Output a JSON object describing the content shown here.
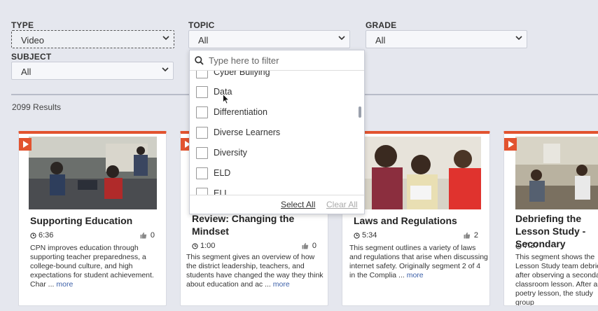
{
  "filters": {
    "type": {
      "label": "TYPE",
      "value": "Video"
    },
    "topic": {
      "label": "TOPIC",
      "value": "All"
    },
    "grade": {
      "label": "GRADE",
      "value": "All"
    },
    "subject": {
      "label": "SUBJECT",
      "value": "All"
    }
  },
  "topic_dropdown": {
    "placeholder": "Type here to filter",
    "options": [
      "Cyber Bullying",
      "Data",
      "Differentiation",
      "Diverse Learners",
      "Diversity",
      "ELD",
      "ELL"
    ],
    "select_all": "Select All",
    "clear_all": "Clear All"
  },
  "results": {
    "count_text": "2099 Results"
  },
  "cards": [
    {
      "title": "Supporting Education",
      "duration": "6:36",
      "likes": "0",
      "description": "CPN improves education through supporting teacher preparedness, a college-bound culture, and high expectations for student achievement. Char ...",
      "more": "more"
    },
    {
      "title": "Review: Changing the Mindset",
      "duration": "1:00",
      "likes": "0",
      "description": "This segment gives an overview of how the district leadership, teachers, and students have changed the way they think about education and ac ...",
      "more": "more"
    },
    {
      "title": "Laws and Regulations",
      "duration": "5:34",
      "likes": "2",
      "description": "This segment outlines a variety of laws and regulations that arise when discussing internet safety. Originally segment 2 of 4 in the Complia ...",
      "more": "more"
    },
    {
      "title": "Debriefing the Lesson Study - Secondary",
      "duration": "7:37",
      "likes": "",
      "description": "This segment shows the Lesson Study team debriefing after observing a secondary classroom lesson. After a poetry lesson, the study group",
      "more": ""
    }
  ],
  "icons": {
    "chevron": "chevron-down-icon",
    "search": "search-icon",
    "clock": "clock-icon",
    "like": "thumbs-up-icon",
    "play": "play-icon"
  },
  "colors": {
    "accent": "#e2532f",
    "link": "#3b5fa8",
    "background": "#e5e7ee"
  }
}
